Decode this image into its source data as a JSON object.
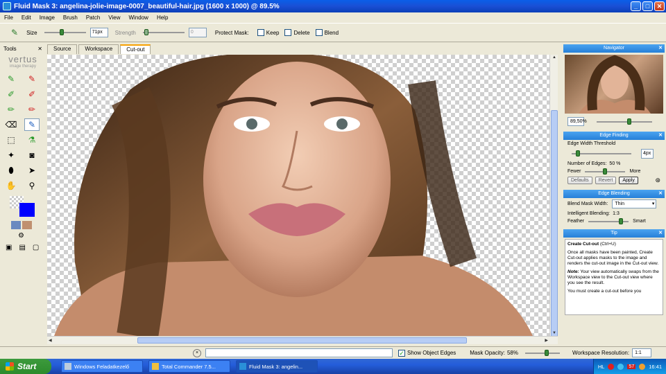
{
  "window": {
    "title": "Fluid Mask 3: angelina-jolie-image-0007_beautiful-hair.jpg (1600 x 1000) @ 89.5%",
    "minimize": "_",
    "maximize": "□",
    "close": "✕"
  },
  "menu": [
    "File",
    "Edit",
    "Image",
    "Brush",
    "Patch",
    "View",
    "Window",
    "Help"
  ],
  "toolbar": {
    "size_label": "Size",
    "size_value": "71px",
    "strength_label": "Strength",
    "strength_value": "0",
    "protect_mask_label": "Protect Mask:",
    "keep_label": "Keep",
    "delete_label": "Delete",
    "blend_label": "Blend"
  },
  "tools_panel": {
    "title": "Tools",
    "brand": "vertus",
    "brand_sub": "image therapy"
  },
  "tabs": [
    {
      "label": "Source"
    },
    {
      "label": "Workspace"
    },
    {
      "label": "Cut-out"
    }
  ],
  "status": {
    "show_object_edges_label": "Show Object Edges",
    "mask_opacity_label": "Mask Opacity:",
    "mask_opacity_value": "58%",
    "workspace_resolution_label": "Workspace Resolution:",
    "workspace_resolution_value": "1:1"
  },
  "navigator": {
    "title": "Navigator",
    "zoom": "89,50%"
  },
  "edge_finding": {
    "title": "Edge Finding",
    "threshold_label": "Edge Width Threshold",
    "threshold_value": "4px",
    "num_edges_label": "Number of Edges:",
    "num_edges_value": "50 %",
    "fewer": "Fewer",
    "more": "More",
    "defaults": "Defaults",
    "revert": "Revert",
    "apply": "Apply"
  },
  "edge_blending": {
    "title": "Edge Blending",
    "blend_width_label": "Blend Mask Width:",
    "blend_width_value": "Thin",
    "intelligent_label": "Intelligent Blending:",
    "intelligent_value": "1:3",
    "feather": "Feather",
    "smart": "Smart"
  },
  "tip": {
    "title": "Tip",
    "heading": "Create Cut-out",
    "shortcut": "(Ctrl+U)",
    "p1": "Once all masks have been painted, Create Cut-out applies masks to the image and renders the cut-out image in the Cut-out view.",
    "note_label": "Note:",
    "p2": "Your view automatically swaps from the Workspace view to the Cut-out view where you see the result.",
    "p3": "You must create a cut-out before you"
  },
  "taskbar": {
    "start": "Start",
    "tasks": [
      "Windows Feladatkezelő",
      "Total Commander 7.5...",
      "Fluid Mask 3: angelin..."
    ],
    "lang": "HL",
    "badge": "57",
    "time": "16:41"
  },
  "colors": {
    "accent": "#0a5fe8",
    "foreground_swatch": "#0000ff"
  }
}
